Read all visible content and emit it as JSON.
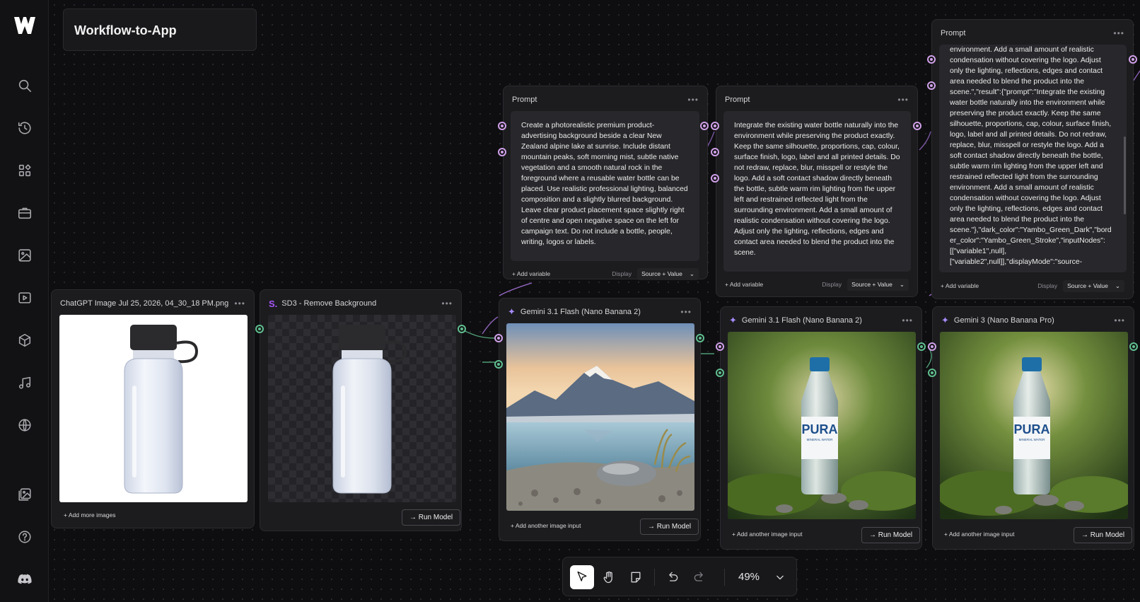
{
  "app": {
    "title": "Workflow-to-App",
    "sidebar_icons": [
      "logo-icon",
      "search-icon",
      "history-icon",
      "apps-icon",
      "toolbox-icon",
      "image-icon",
      "video-icon",
      "cube-icon",
      "music-icon",
      "globe-icon",
      "gallery-icon",
      "help-icon",
      "discord-icon"
    ]
  },
  "nodes": {
    "image_input": {
      "title": "ChatGPT Image Jul 25, 2026, 04_30_18 PM.png",
      "add_label": "+ Add more images"
    },
    "remove_bg": {
      "badge": "S.",
      "title": "SD3 - Remove Background",
      "run_label": "→ Run Model"
    },
    "prompt1": {
      "title": "Prompt",
      "text": "Create a photorealistic premium product-advertising background beside a clear New Zealand alpine lake at sunrise. Include distant mountain peaks, soft morning mist, subtle native vegetation and a smooth natural rock in the foreground where a reusable water bottle can be placed. Use realistic professional lighting, balanced composition and a slightly blurred background. Leave clear product placement space slightly right of centre and open negative space on the left for campaign text. Do not include a bottle, people, writing, logos or labels.",
      "add_variable": "+ Add variable",
      "display_label": "Display",
      "display_value": "Source + Value"
    },
    "prompt2": {
      "title": "Prompt",
      "text": "Integrate the existing water bottle naturally into the environment while preserving the product exactly. Keep the same silhouette, proportions, cap, colour, surface finish, logo, label and all printed details. Do not redraw, replace, blur, misspell or restyle the logo. Add a soft contact shadow directly beneath the bottle, subtle warm rim lighting from the upper left and restrained reflected light from the surrounding environment. Add a small amount of realistic condensation without covering the logo. Adjust only the lighting, reflections, edges and contact area needed to blend the product into the scene.",
      "add_variable": "+ Add variable",
      "display_label": "Display",
      "display_value": "Source + Value"
    },
    "prompt3": {
      "title": "Prompt",
      "text": "environment. Add a small amount of realistic condensation without covering the logo. Adjust only the lighting, reflections, edges and contact area needed to blend the product into the scene.\",\"result\":{\"prompt\":\"Integrate the existing water bottle naturally into the environment while preserving the product exactly. Keep the same silhouette, proportions, cap, colour, surface finish, logo, label and all printed details. Do not redraw, replace, blur, misspell or restyle the logo. Add a soft contact shadow directly beneath the bottle, subtle warm rim lighting from the upper left and restrained reflected light from the surrounding environment. Add a small amount of realistic condensation without covering the logo. Adjust only the lighting, reflections, edges and contact area needed to blend the product into the scene.\"},\"dark_color\":\"Yambo_Green_Dark\",\"border_color\":\"Yambo_Green_Stroke\",\"inputNodes\":[[\"variable1\",null],[\"variable2\",null]],\"displayMode\":\"source-",
      "add_variable": "+ Add variable",
      "display_label": "Display",
      "display_value": "Source + Value"
    },
    "gemini1": {
      "title": "Gemini 3.1 Flash (Nano Banana 2)",
      "add_input": "+ Add another image input",
      "run_label": "→ Run Model"
    },
    "gemini2": {
      "title": "Gemini 3.1 Flash (Nano Banana 2)",
      "add_input": "+ Add another image input",
      "run_label": "→ Run Model",
      "bottle_brand": "PURA",
      "bottle_sub": "MINERAL WATER"
    },
    "gemini3": {
      "title": "Gemini 3 (Nano Banana Pro)",
      "add_input": "+ Add another image input",
      "run_label": "→ Run Model",
      "bottle_brand": "PURA",
      "bottle_sub": "MINERAL WATER"
    }
  },
  "toolbar": {
    "zoom": "49%",
    "tools": [
      "pointer-icon",
      "hand-icon",
      "sticky-note-icon",
      "undo-icon",
      "redo-icon",
      "chevron-down-icon"
    ]
  },
  "colors": {
    "accent": "#a855f7",
    "port_purple": "#d0a0e8",
    "port_green": "#5fbf8f"
  }
}
